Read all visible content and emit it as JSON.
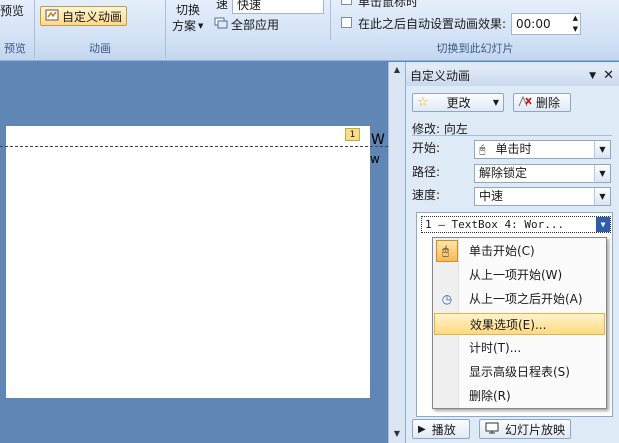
{
  "ribbon": {
    "preview_group_label": "预览",
    "custom_anim_button": "自定义动画",
    "animation_group_label": "动画",
    "transition_scheme_line1": "切换",
    "transition_scheme_line2": "方案",
    "speed_label_partial": "速",
    "speed_value": "快速",
    "apply_all_label": "全部应用",
    "on_click_partial": "单击鼠标时",
    "auto_after_label": "在此之后自动设置动画效果:",
    "auto_after_value": "00:00",
    "transition_group_label": "切换到此幻灯片"
  },
  "slide": {
    "tag": "1",
    "right_text_1": "W",
    "right_text_2": "w"
  },
  "pane": {
    "title": "自定义动画",
    "change_button": "更改",
    "delete_button": "删除",
    "modify_label": "修改: 向左",
    "start_label": "开始:",
    "start_value": "单击时",
    "path_label": "路径:",
    "path_value": "解除锁定",
    "speed_label": "速度:",
    "speed_value": "中速",
    "list_item": "1   — TextBox 4: Wor...",
    "play_button": "播放",
    "slideshow_button": "幻灯片放映"
  },
  "menu": {
    "items": [
      {
        "label": "单击开始(C)"
      },
      {
        "label": "从上一项开始(W)"
      },
      {
        "label": "从上一项之后开始(A)"
      },
      {
        "label": "效果选项(E)..."
      },
      {
        "label": "计时(T)..."
      },
      {
        "label": "显示高级日程表(S)"
      },
      {
        "label": "删除(R)"
      }
    ]
  }
}
